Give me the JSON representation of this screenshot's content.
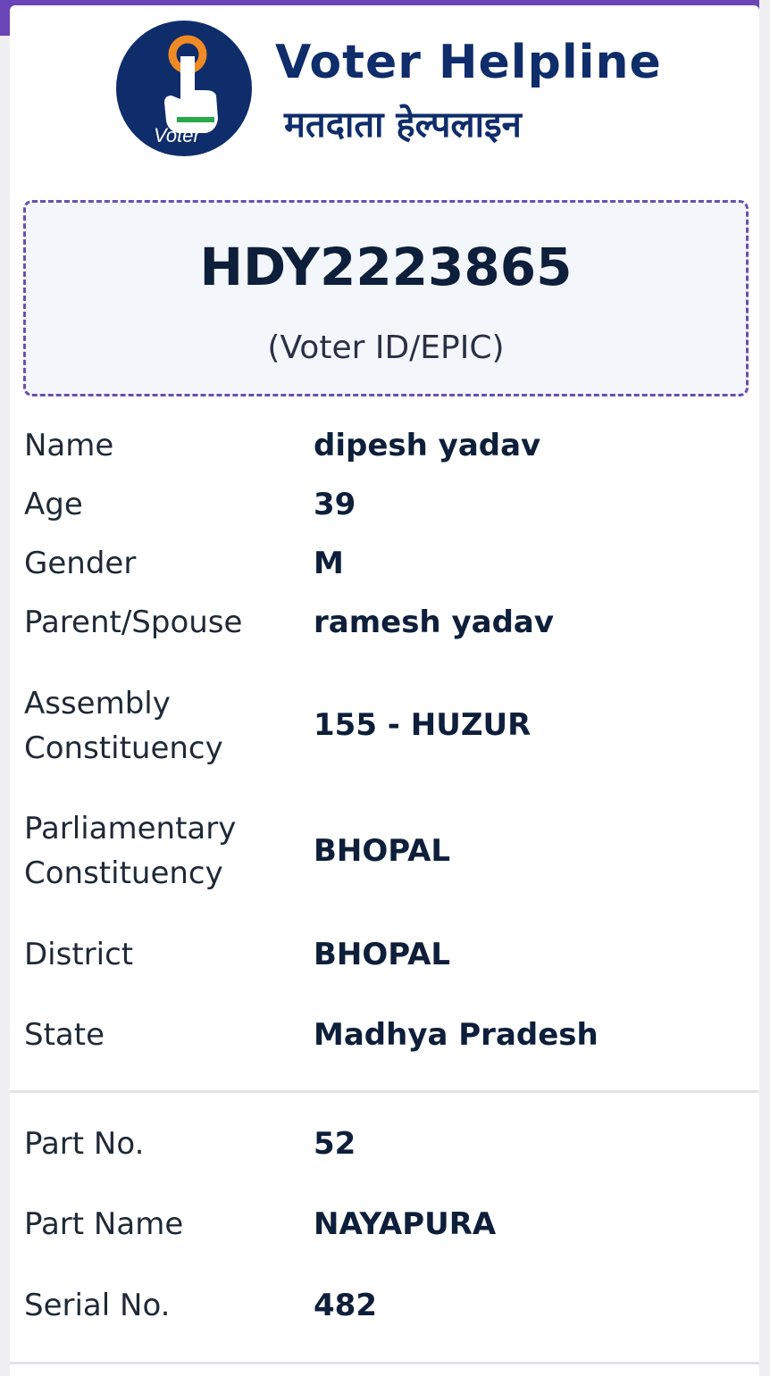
{
  "header": {
    "title_en": "Voter Helpline",
    "title_hi": "मतदाता हेल्पलाइन",
    "logo_text": "Voter"
  },
  "epic": {
    "number": "HDY2223865",
    "label": "(Voter ID/EPIC)"
  },
  "details": {
    "name": {
      "label": "Name",
      "value": "dipesh yadav"
    },
    "age": {
      "label": "Age",
      "value": "39"
    },
    "gender": {
      "label": "Gender",
      "value": "M"
    },
    "parent": {
      "label": "Parent/Spouse",
      "value": "ramesh yadav"
    },
    "assembly": {
      "label_1": "Assembly",
      "label_2": "Constituency",
      "value": "155 - HUZUR"
    },
    "parliamentary": {
      "label_1": "Parliamentary",
      "label_2": "Constituency",
      "value": "BHOPAL"
    },
    "district": {
      "label": "District",
      "value": "BHOPAL"
    },
    "state": {
      "label": "State",
      "value": "Madhya Pradesh"
    }
  },
  "part": {
    "part_no": {
      "label": "Part No.",
      "value": "52"
    },
    "part_name": {
      "label": "Part Name",
      "value": "NAYAPURA"
    },
    "serial_no": {
      "label": "Serial No.",
      "value": "482"
    }
  },
  "colors": {
    "brand": "#0f2d6b",
    "accent": "#6a45b8",
    "logo_orange": "#f08a24",
    "logo_green": "#2aa84a"
  },
  "icons": {
    "logo": "voter-helpline-logo-icon"
  }
}
